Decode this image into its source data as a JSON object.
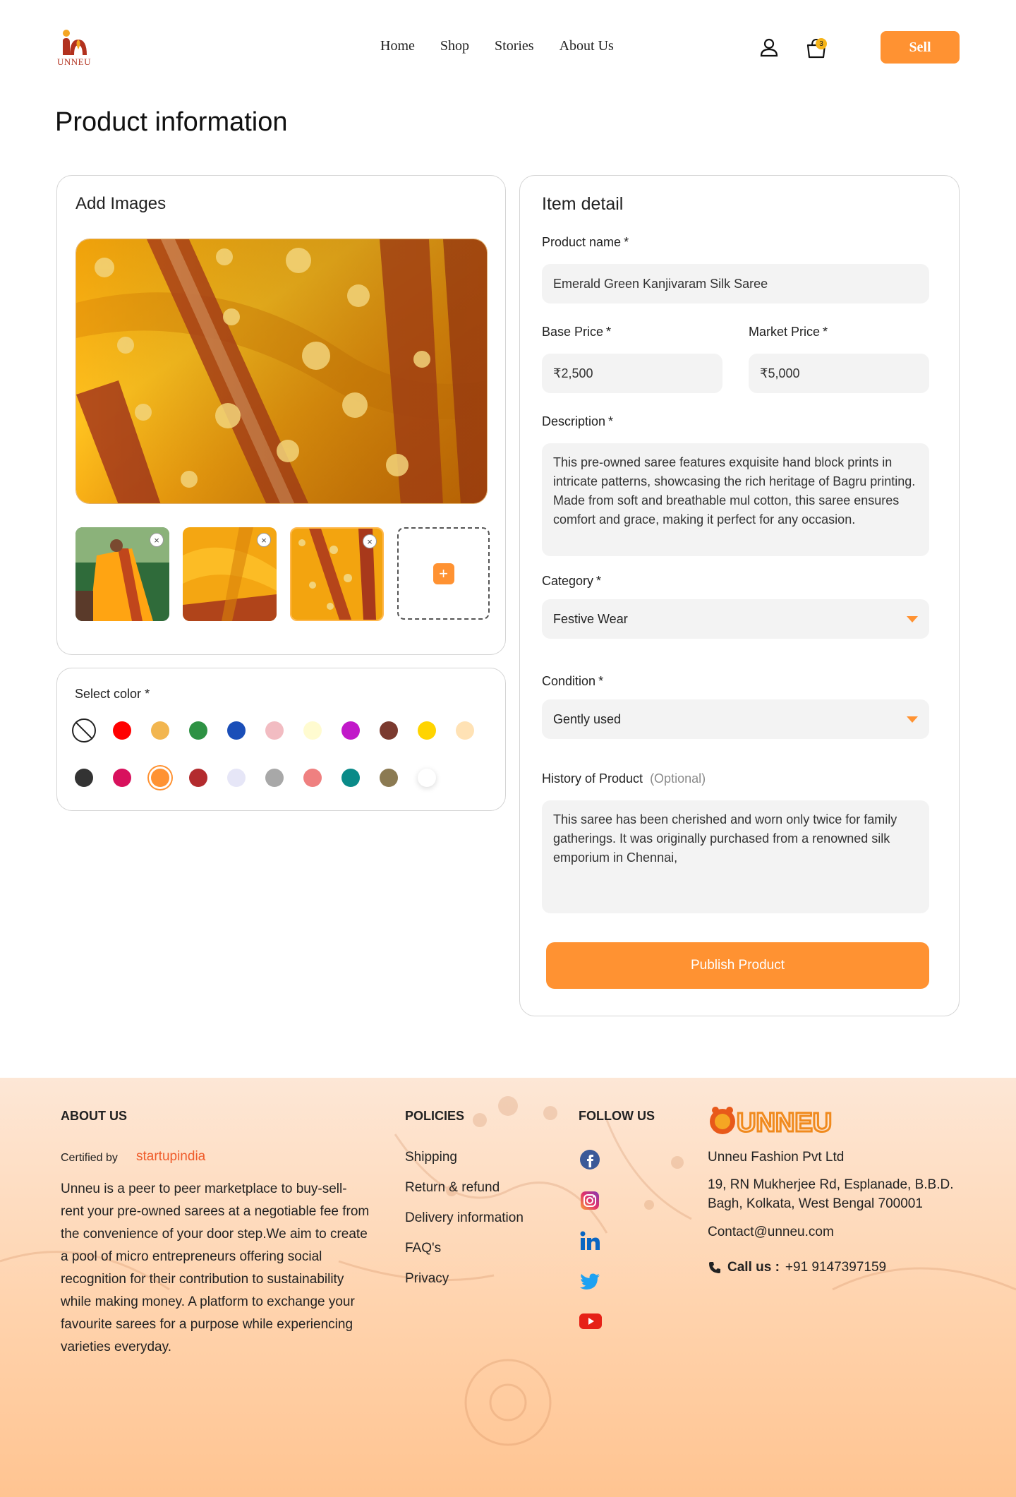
{
  "header": {
    "logo_text": "UNNEU",
    "nav": [
      "Home",
      "Shop",
      "Stories",
      "About Us"
    ],
    "cart_count": "3",
    "sell_label": "Sell"
  },
  "page_title": "Product information",
  "images_card": {
    "heading": "Add Images",
    "thumb_close": "×",
    "add_symbol": "+"
  },
  "colors_card": {
    "label": "Select color",
    "required": "*",
    "row1": [
      "none",
      "#ff0000",
      "#f2b650",
      "#2e9244",
      "#1a4eb8",
      "#f2bcc2",
      "#fffbd0",
      "#c119c9",
      "#7b3a2f",
      "#ffd400",
      "#ffe2b5"
    ],
    "row2": [
      "#333333",
      "#d8115d",
      "#ff9232",
      "#b32b2e",
      "#e6e6f7",
      "#a8a8a8",
      "#ef8080",
      "#0a8a88",
      "#8b7a52",
      "#ffffff"
    ],
    "selected": "#ff9232"
  },
  "item_detail": {
    "heading": "Item detail",
    "product_name_label": "Product name",
    "product_name_value": "Emerald Green Kanjivaram Silk Saree",
    "base_price_label": "Base Price",
    "base_price_value": "₹2,500",
    "market_price_label": "Market Price",
    "market_price_value": "₹5,000",
    "description_label": "Description",
    "description_value": "This pre-owned saree features exquisite hand block prints in intricate patterns, showcasing the rich heritage of Bagru printing. Made from soft and breathable mul cotton, this saree ensures comfort and grace, making it perfect for any occasion.",
    "category_label": "Category",
    "category_value": "Festive Wear",
    "condition_label": "Condition",
    "condition_value": "Gently used",
    "history_label": "History of Product",
    "history_optional": "(Optional)",
    "history_value": "This saree has been cherished and worn only twice for family gatherings. It was originally purchased from a renowned silk emporium in Chennai,",
    "required": "*",
    "publish_label": "Publish Product"
  },
  "footer": {
    "about_heading": "ABOUT US",
    "certified_by": "Certified by",
    "startup": "startupindia",
    "about_text": "Unneu is a peer to peer marketplace to buy-sell- rent your pre-owned sarees at a negotiable fee from the convenience of your door step.We aim to create a pool of micro entrepreneurs offering social recognition for their contribution to sustainability while making money. A platform to exchange your favourite sarees for a purpose while experiencing varieties everyday.",
    "policies_heading": "POLICIES",
    "policies": [
      "Shipping",
      "Return & refund",
      "Delivery information",
      "FAQ's",
      "Privacy"
    ],
    "follow_heading": "FOLLOW US",
    "social_icons": [
      "facebook-icon",
      "instagram-icon",
      "linkedin-icon",
      "twitter-icon",
      "youtube-icon"
    ],
    "company_name": "Unneu Fashion Pvt Ltd",
    "address": "19, RN Mukherjee Rd, Esplanade, B.B.D. Bagh, Kolkata, West Bengal 700001",
    "contact": "Contact@unneu.com",
    "call_label": "Call us :",
    "call_value": "+91 9147397159",
    "brand_logo_text": "UNNEU"
  },
  "colors": {
    "accent": "#ff9232",
    "brand_red": "#b2311e"
  }
}
